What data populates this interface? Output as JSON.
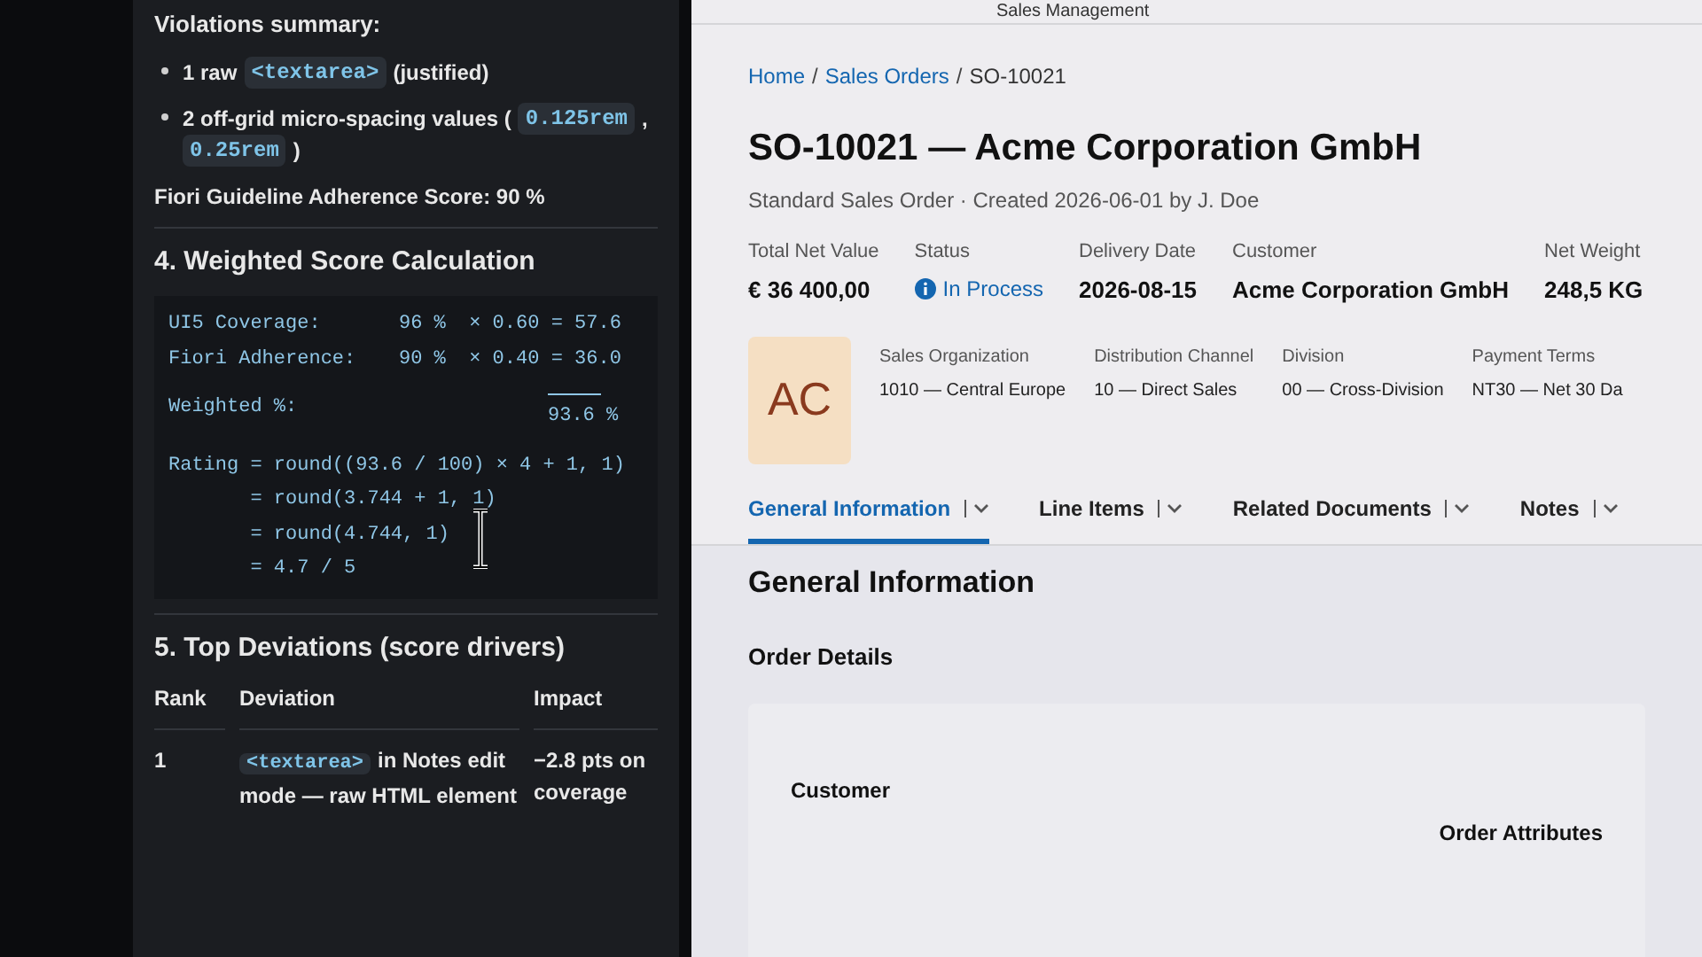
{
  "report": {
    "violations_heading": "Violations summary:",
    "bullets": [
      [
        {
          "kind": "text",
          "text": "1 raw"
        },
        {
          "kind": "code",
          "text": "<textarea>"
        },
        {
          "kind": "text",
          "text": "(justified)"
        }
      ],
      [
        {
          "kind": "text",
          "text": "2 off-grid micro-spacing values ("
        },
        {
          "kind": "code",
          "text": "0.125rem"
        },
        {
          "kind": "text",
          "text": ","
        },
        {
          "kind": "code",
          "text": "0.25rem"
        },
        {
          "kind": "text",
          "text": ")"
        }
      ]
    ],
    "adherence": "Fiori Guideline Adherence Score: 90 %",
    "calc_heading": "4. Weighted Score Calculation",
    "calc_rows": [
      {
        "label": "UI5 Coverage:",
        "value": "96 %  × 0.60 = 57.6"
      },
      {
        "label": "Fiori Adherence:",
        "value": "90 %  × 0.40 = 36.0"
      }
    ],
    "weighted_label": "Weighted %:",
    "weighted_value": "93.6 %",
    "rating_lines": [
      "Rating = round((93.6 / 100) × 4 + 1, 1)",
      "       = round(3.744 + 1, 1)",
      "       = round(4.744, 1)",
      "       = 4.7 / 5"
    ],
    "deviations_heading": "5. Top Deviations (score drivers)",
    "table": {
      "columns": [
        "Rank",
        "Deviation",
        "Impact"
      ],
      "rows": [
        {
          "rank": "1",
          "code": "<textarea>",
          "text": "in Notes edit mode — raw HTML element",
          "impact": "−2.8 pts on coverage"
        }
      ]
    }
  },
  "app": {
    "header": "Sales Management",
    "breadcrumb_separator": "/",
    "breadcrumb": [
      {
        "label": "Home",
        "link": true
      },
      {
        "label": "Sales Orders",
        "link": true
      },
      {
        "label": "SO-10021",
        "link": false
      }
    ],
    "title": "SO-10021 — Acme Corporation GmbH",
    "subtitle": "Standard Sales Order · Created 2026-06-01 by J. Doe",
    "kpis": [
      {
        "label": "Total Net Value",
        "value": "€ 36 400,00",
        "kind": "value"
      },
      {
        "label": "Status",
        "value": "In Process",
        "kind": "status"
      },
      {
        "label": "Delivery Date",
        "value": "2026-08-15",
        "kind": "value"
      },
      {
        "label": "Customer",
        "value": "Acme Corporation GmbH",
        "kind": "value"
      },
      {
        "label": "Net Weight",
        "value": "248,5 KG",
        "kind": "value"
      }
    ],
    "avatar": "AC",
    "attributes": [
      {
        "label": "Sales Organization",
        "value": "1010 — Central Europe"
      },
      {
        "label": "Distribution Channel",
        "value": "10 — Direct Sales"
      },
      {
        "label": "Division",
        "value": "00 — Cross-Division"
      },
      {
        "label": "Payment Terms",
        "value": "NT30 — Net 30 Da"
      }
    ],
    "tabs": [
      {
        "label": "General Information",
        "selected": true
      },
      {
        "label": "Line Items",
        "selected": false
      },
      {
        "label": "Related Documents",
        "selected": false
      },
      {
        "label": "Notes",
        "selected": false
      }
    ],
    "section_title": "General Information",
    "subsection_title": "Order Details",
    "card_labels": [
      "Customer",
      "Order Attributes"
    ]
  }
}
